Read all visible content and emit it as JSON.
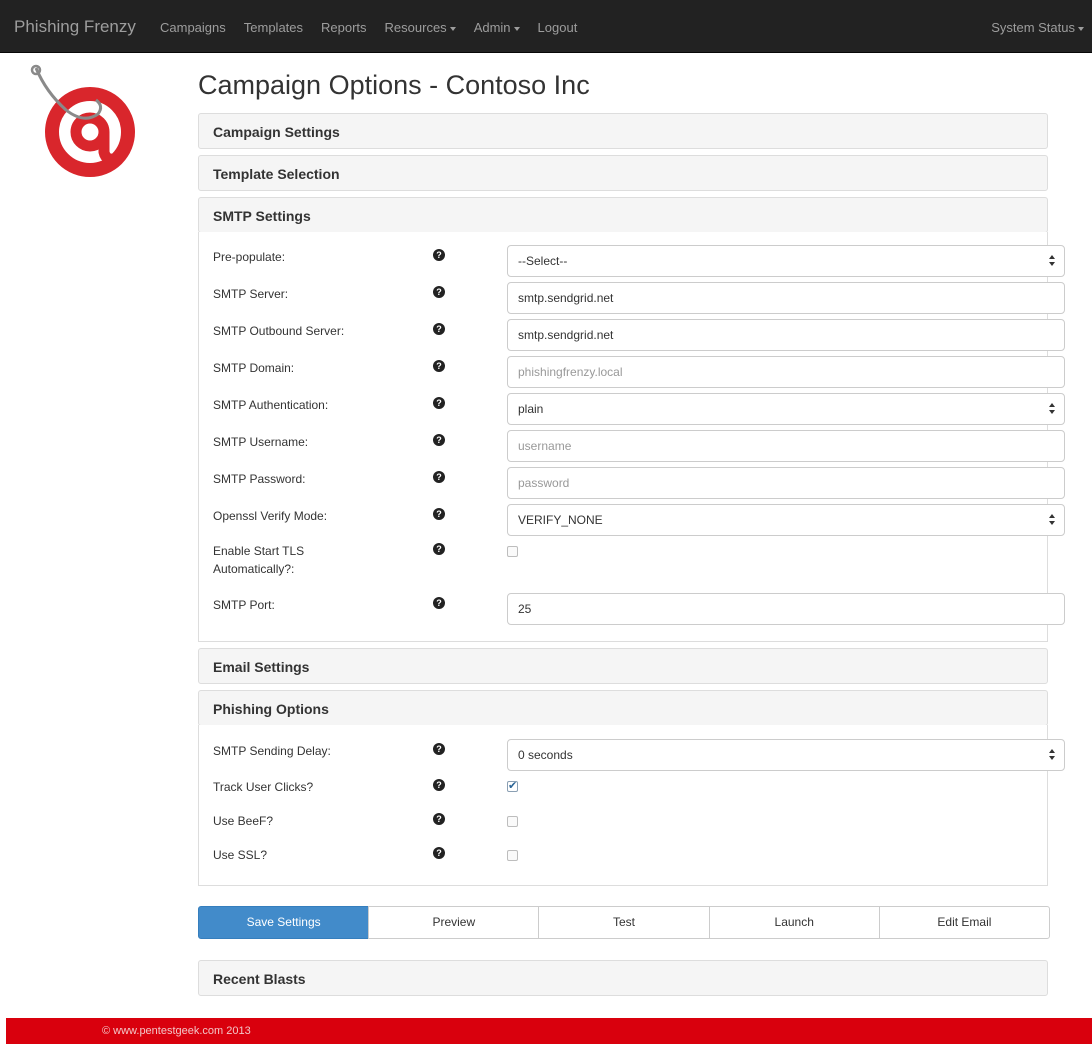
{
  "navbar": {
    "brand": "Phishing Frenzy",
    "items": [
      {
        "label": "Campaigns",
        "dropdown": false
      },
      {
        "label": "Templates",
        "dropdown": false
      },
      {
        "label": "Reports",
        "dropdown": false
      },
      {
        "label": "Resources",
        "dropdown": true
      },
      {
        "label": "Admin",
        "dropdown": true
      },
      {
        "label": "Logout",
        "dropdown": false
      }
    ],
    "right": {
      "label": "System Status",
      "dropdown": true
    }
  },
  "page": {
    "title": "Campaign Options - Contoso Inc"
  },
  "panels": {
    "campaign_settings": "Campaign Settings",
    "template_selection": "Template Selection",
    "smtp_settings": "SMTP Settings",
    "email_settings": "Email Settings",
    "phishing_options": "Phishing Options",
    "recent_blasts": "Recent Blasts"
  },
  "smtp": {
    "prepopulate": {
      "label": "Pre-populate:",
      "value": "--Select--"
    },
    "server": {
      "label": "SMTP Server:",
      "value": "smtp.sendgrid.net"
    },
    "outbound_server": {
      "label": "SMTP Outbound Server:",
      "value": "smtp.sendgrid.net"
    },
    "domain": {
      "label": "SMTP Domain:",
      "placeholder": "phishingfrenzy.local"
    },
    "authentication": {
      "label": "SMTP Authentication:",
      "value": "plain"
    },
    "username": {
      "label": "SMTP Username:",
      "placeholder": "username"
    },
    "password": {
      "label": "SMTP Password:",
      "placeholder": "password"
    },
    "openssl_verify": {
      "label": "Openssl Verify Mode:",
      "value": "VERIFY_NONE"
    },
    "start_tls": {
      "label_line1": "Enable Start TLS",
      "label_line2": "Automatically?:",
      "checked": false
    },
    "port": {
      "label": "SMTP Port:",
      "value": "25"
    }
  },
  "phishing": {
    "sending_delay": {
      "label": "SMTP Sending Delay:",
      "value": "0 seconds"
    },
    "track_clicks": {
      "label": "Track User Clicks?",
      "checked": true
    },
    "use_beef": {
      "label": "Use BeeF?",
      "checked": false
    },
    "use_ssl": {
      "label": "Use SSL?",
      "checked": false
    }
  },
  "help_icon_glyph": "?",
  "buttons": {
    "save": "Save Settings",
    "preview": "Preview",
    "test": "Test",
    "launch": "Launch",
    "edit_email": "Edit Email"
  },
  "footer": {
    "text": "© www.pentestgeek.com 2013"
  },
  "colors": {
    "navbar": "#222222",
    "primary": "#428bca",
    "footer": "#d9000d",
    "logo": "#d9262c"
  }
}
